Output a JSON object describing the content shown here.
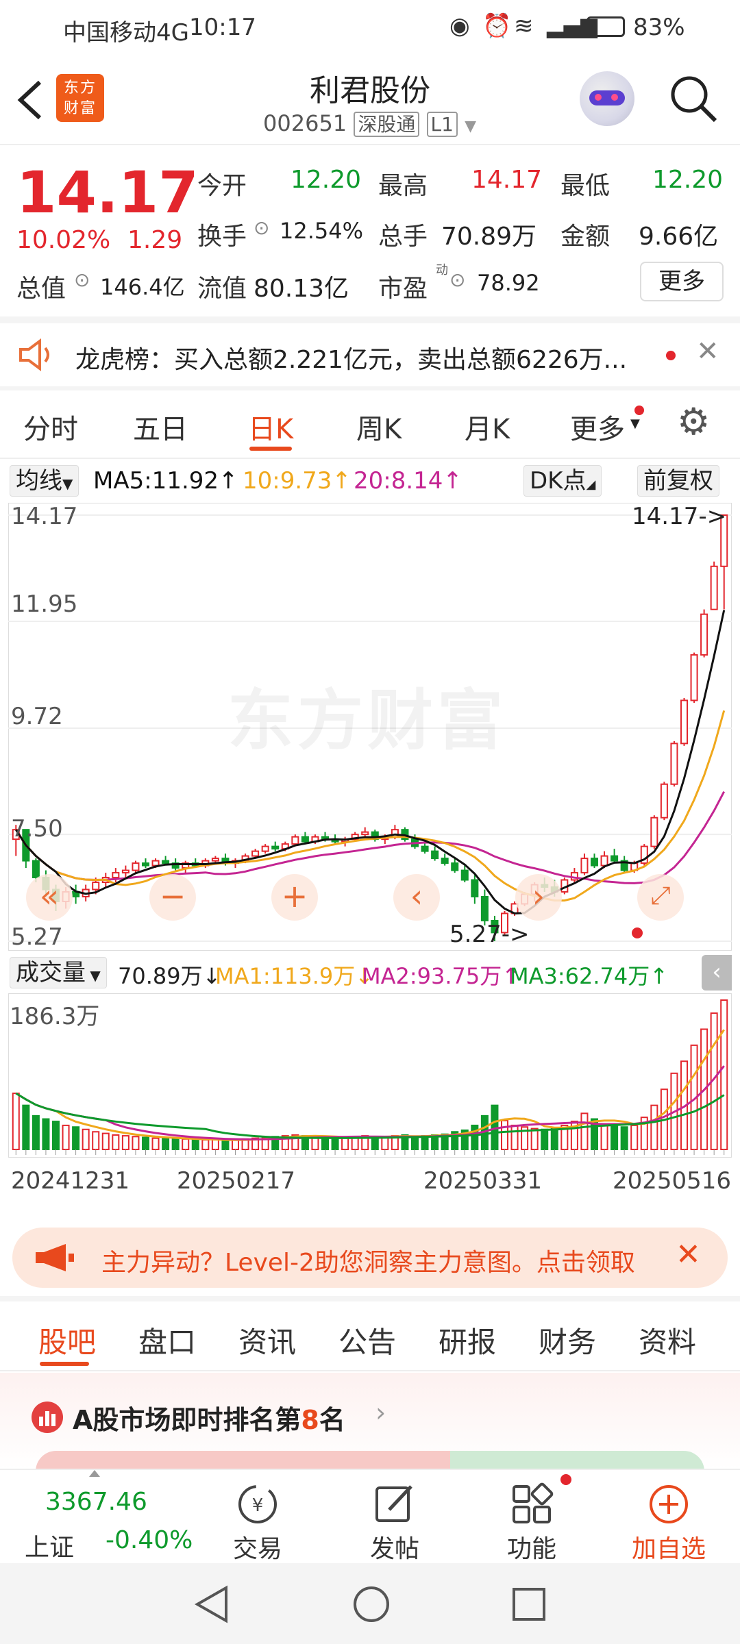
{
  "status_bar": {
    "carrier": "中国移动4G",
    "time": "10:17",
    "battery": "83%"
  },
  "header": {
    "back_icon": "chevron-left-icon",
    "logo_text": "东方财富",
    "stock_name": "利君股份",
    "stock_code": "002651",
    "tag1": "深股通",
    "tag2": "L1",
    "search_icon": "search-icon"
  },
  "quote": {
    "price": "14.17",
    "change_pct": "10.02%",
    "change": "1.29",
    "open_label": "今开",
    "open": "12.20",
    "high_label": "最高",
    "high": "14.17",
    "low_label": "最低",
    "low": "12.20",
    "turnover_label": "换手",
    "turnover": "12.54%",
    "volume_label": "总手",
    "volume": "70.89万",
    "amount_label": "金额",
    "amount": "9.66亿",
    "mktcap_label": "总值",
    "mktcap": "146.4亿",
    "float_label": "流值",
    "float": "80.13亿",
    "pe_label": "市盈",
    "pe_sup": "动",
    "pe": "78.92",
    "more_button": "更多"
  },
  "notice": {
    "text": "龙虎榜：买入总额2.221亿元，卖出总额6226万..."
  },
  "chart_tabs": [
    "分时",
    "五日",
    "日K",
    "周K",
    "月K",
    "更多"
  ],
  "active_chart_tab": "日K",
  "ma_bar": {
    "selector": "均线",
    "ma5": "MA5:11.92↑",
    "ma10": "10:9.73↑",
    "ma20": "20:8.14↑",
    "dk": "DK点",
    "adjust": "前复权"
  },
  "kline": {
    "y_labels": [
      "14.17",
      "11.95",
      "9.72",
      "7.50",
      "5.27"
    ],
    "max_label": "14.17->",
    "min_label": "5.27->",
    "watermark": "东方财富"
  },
  "volume_bar": {
    "selector": "成交量",
    "vol": "70.89万↓",
    "ma1": "MA1:113.9万↓",
    "ma2": "MA2:93.75万↑",
    "ma3": "MA3:62.74万↑",
    "y_label": "186.3万"
  },
  "dates": [
    "20241231",
    "20250217",
    "20250331",
    "20250516"
  ],
  "banner": {
    "text": "主力异动？Level-2助您洞察主力意图。点击领取"
  },
  "content_tabs": [
    "股吧",
    "盘口",
    "资讯",
    "公告",
    "研报",
    "财务",
    "资料"
  ],
  "active_content_tab": "股吧",
  "rank": {
    "prefix": "A股市场即时排名第",
    "num": "8",
    "suffix": "名"
  },
  "bottom_bar": {
    "index_value": "3367.46",
    "index_name": "上证",
    "index_change": "-0.40%",
    "items": [
      {
        "label": "交易",
        "icon": "trade-icon"
      },
      {
        "label": "发帖",
        "icon": "post-icon"
      },
      {
        "label": "功能",
        "icon": "grid-icon"
      },
      {
        "label": "加自选",
        "icon": "add-watchlist-icon"
      }
    ]
  },
  "colors": {
    "up": "#e3262d",
    "down": "#0e9a2c",
    "accent": "#e8491d"
  },
  "chart_data": {
    "type": "candlestick",
    "ylim": [
      5.27,
      14.17
    ],
    "y_ticks": [
      14.17,
      11.95,
      9.72,
      7.5,
      5.27
    ],
    "candles": [
      [
        7.4,
        7.7,
        7.05,
        7.6
      ],
      [
        7.6,
        7.6,
        6.8,
        6.95
      ],
      [
        6.95,
        7.0,
        6.5,
        6.6
      ],
      [
        6.6,
        6.75,
        6.2,
        6.35
      ],
      [
        6.35,
        6.45,
        5.9,
        6.1
      ],
      [
        6.1,
        6.4,
        5.95,
        6.3
      ],
      [
        6.3,
        6.45,
        6.05,
        6.2
      ],
      [
        6.2,
        6.45,
        6.1,
        6.35
      ],
      [
        6.35,
        6.6,
        6.25,
        6.5
      ],
      [
        6.5,
        6.7,
        6.4,
        6.6
      ],
      [
        6.6,
        6.8,
        6.5,
        6.7
      ],
      [
        6.7,
        6.85,
        6.6,
        6.75
      ],
      [
        6.75,
        6.95,
        6.7,
        6.9
      ],
      [
        6.9,
        7.0,
        6.8,
        6.85
      ],
      [
        6.85,
        7.0,
        6.8,
        6.95
      ],
      [
        6.95,
        7.05,
        6.85,
        6.9
      ],
      [
        6.9,
        7.0,
        6.75,
        6.8
      ],
      [
        6.8,
        6.95,
        6.7,
        6.9
      ],
      [
        6.9,
        7.0,
        6.8,
        6.85
      ],
      [
        6.85,
        7.0,
        6.8,
        6.95
      ],
      [
        6.95,
        7.05,
        6.9,
        7.0
      ],
      [
        7.0,
        7.1,
        6.85,
        6.9
      ],
      [
        6.9,
        7.0,
        6.8,
        6.95
      ],
      [
        6.95,
        7.1,
        6.9,
        7.05
      ],
      [
        7.05,
        7.2,
        7.0,
        7.15
      ],
      [
        7.15,
        7.3,
        7.1,
        7.25
      ],
      [
        7.25,
        7.35,
        7.15,
        7.2
      ],
      [
        7.2,
        7.35,
        7.15,
        7.3
      ],
      [
        7.3,
        7.5,
        7.25,
        7.45
      ],
      [
        7.45,
        7.55,
        7.3,
        7.35
      ],
      [
        7.35,
        7.5,
        7.3,
        7.45
      ],
      [
        7.45,
        7.55,
        7.35,
        7.4
      ],
      [
        7.4,
        7.5,
        7.3,
        7.35
      ],
      [
        7.35,
        7.45,
        7.25,
        7.4
      ],
      [
        7.4,
        7.55,
        7.35,
        7.5
      ],
      [
        7.5,
        7.65,
        7.45,
        7.55
      ],
      [
        7.55,
        7.6,
        7.35,
        7.4
      ],
      [
        7.4,
        7.5,
        7.3,
        7.45
      ],
      [
        7.45,
        7.7,
        7.4,
        7.6
      ],
      [
        7.6,
        7.65,
        7.35,
        7.4
      ],
      [
        7.4,
        7.5,
        7.2,
        7.25
      ],
      [
        7.25,
        7.35,
        7.1,
        7.15
      ],
      [
        7.15,
        7.25,
        6.95,
        7.0
      ],
      [
        7.0,
        7.1,
        6.85,
        6.9
      ],
      [
        6.9,
        7.0,
        6.7,
        6.75
      ],
      [
        6.75,
        6.85,
        6.5,
        6.55
      ],
      [
        6.55,
        6.65,
        6.05,
        6.2
      ],
      [
        6.2,
        6.35,
        5.6,
        5.7
      ],
      [
        5.7,
        5.8,
        5.27,
        5.45
      ],
      [
        5.45,
        5.9,
        5.4,
        5.85
      ],
      [
        5.85,
        6.1,
        5.8,
        6.05
      ],
      [
        6.05,
        6.3,
        6.0,
        6.25
      ],
      [
        6.25,
        6.5,
        6.1,
        6.45
      ],
      [
        6.45,
        6.6,
        6.3,
        6.4
      ],
      [
        6.4,
        6.55,
        6.2,
        6.3
      ],
      [
        6.3,
        6.6,
        6.25,
        6.55
      ],
      [
        6.55,
        6.8,
        6.5,
        6.7
      ],
      [
        6.7,
        7.1,
        6.65,
        7.0
      ],
      [
        7.0,
        7.1,
        6.8,
        6.85
      ],
      [
        6.85,
        7.15,
        6.8,
        7.05
      ],
      [
        7.05,
        7.2,
        6.9,
        6.95
      ],
      [
        6.95,
        7.05,
        6.7,
        6.75
      ],
      [
        6.75,
        6.95,
        6.7,
        6.9
      ],
      [
        6.9,
        7.3,
        6.85,
        7.25
      ],
      [
        7.25,
        7.9,
        7.2,
        7.85
      ],
      [
        7.85,
        8.6,
        7.8,
        8.55
      ],
      [
        8.55,
        9.45,
        8.5,
        9.4
      ],
      [
        9.4,
        10.35,
        9.35,
        10.3
      ],
      [
        10.3,
        11.3,
        10.25,
        11.25
      ],
      [
        11.25,
        12.2,
        11.2,
        12.1
      ],
      [
        12.2,
        13.2,
        12.2,
        13.1
      ],
      [
        13.1,
        14.17,
        12.2,
        14.17
      ]
    ],
    "ma5_color": "#111111",
    "ma10_color": "#f0a81c",
    "ma20_color": "#c42592",
    "volume": {
      "max": 186.3,
      "unit": "万",
      "values": [
        70,
        55,
        42,
        38,
        35,
        30,
        28,
        25,
        22,
        20,
        18,
        17,
        16,
        15,
        14,
        14,
        13,
        13,
        12,
        12,
        12,
        11,
        12,
        13,
        14,
        15,
        16,
        17,
        18,
        17,
        16,
        15,
        14,
        15,
        16,
        17,
        16,
        15,
        17,
        18,
        16,
        17,
        18,
        19,
        22,
        24,
        30,
        42,
        55,
        36,
        30,
        28,
        26,
        25,
        27,
        30,
        35,
        45,
        38,
        32,
        30,
        28,
        30,
        40,
        55,
        75,
        95,
        110,
        130,
        150,
        170,
        186.3
      ]
    }
  }
}
